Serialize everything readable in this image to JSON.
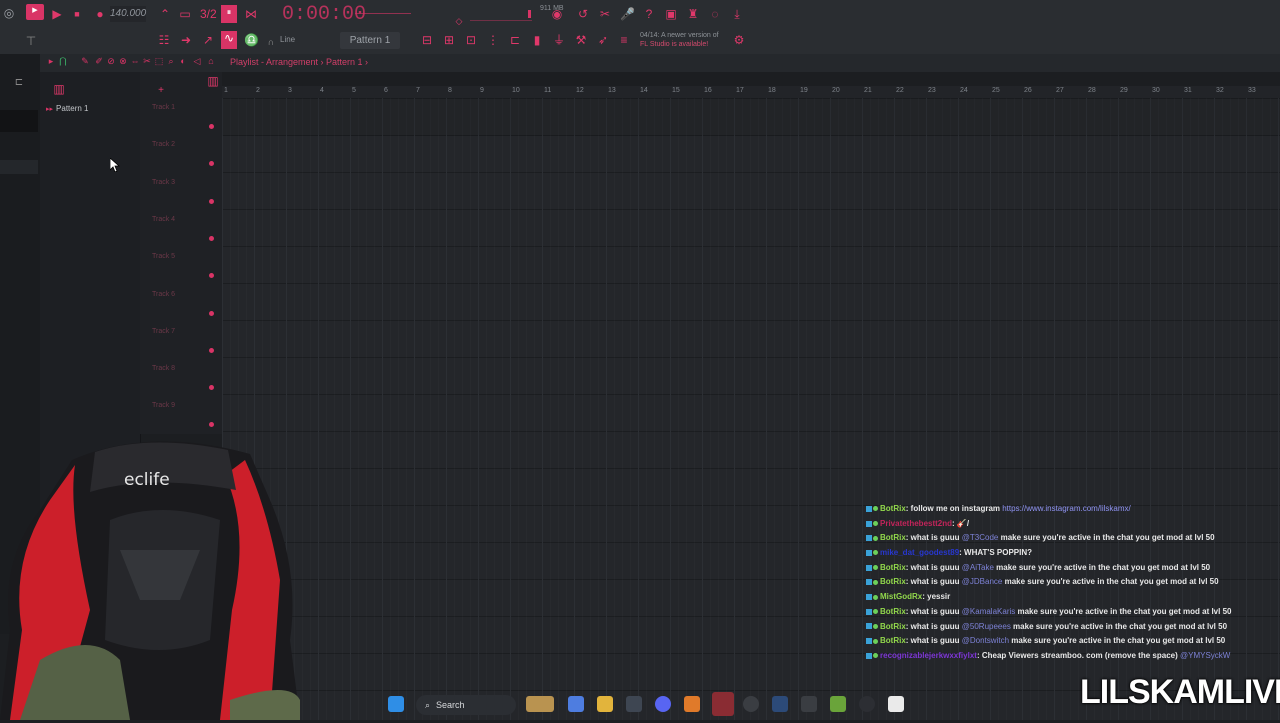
{
  "toolbar": {
    "bpm": "140.000",
    "time": "0:00:00",
    "memory": "911 MB",
    "snap_mode": "Line",
    "pattern": "Pattern 1",
    "news_line1": "04/14: A newer version of",
    "news_line2": "FL Studio is available!"
  },
  "playlist": {
    "breadcrumb": "Playlist - Arrangement › Pattern 1 ›",
    "picker_item": "Pattern 1",
    "tracks": [
      "Track 1",
      "Track 2",
      "Track 3",
      "Track 4",
      "Track 5",
      "Track 6",
      "Track 7",
      "Track 8",
      "Track 9"
    ],
    "ruler": [
      "1",
      "2",
      "3",
      "4",
      "5",
      "6",
      "7",
      "8",
      "9",
      "10",
      "11",
      "12",
      "13",
      "14",
      "15",
      "16",
      "17",
      "18",
      "19",
      "20",
      "21",
      "22",
      "23",
      "24",
      "25",
      "26",
      "27",
      "28",
      "29",
      "30",
      "31",
      "32",
      "33"
    ]
  },
  "chat": {
    "messages": [
      {
        "user": "BotRix",
        "color": "green",
        "pre": ": follow me on instagram ",
        "mention": "",
        "link": "https://www.instagram.com/lilskamx/",
        "post": ""
      },
      {
        "user": "Privatethebestt2nd",
        "color": "red",
        "pre": ": 🎸/",
        "mention": "",
        "link": "",
        "post": ""
      },
      {
        "user": "BotRix",
        "color": "green",
        "pre": ": what is guuu ",
        "mention": "@T3Code",
        "link": "",
        "post": " make sure you're active in the chat you get mod at lvl 50"
      },
      {
        "user": "mike_dat_goodest89",
        "color": "blue",
        "pre": ": WHAT'S POPPIN?",
        "mention": "",
        "link": "",
        "post": ""
      },
      {
        "user": "BotRix",
        "color": "green",
        "pre": ": what is guuu ",
        "mention": "@AiTake",
        "link": "",
        "post": " make sure you're active in the chat you get mod at lvl 50"
      },
      {
        "user": "BotRix",
        "color": "green",
        "pre": ": what is guuu ",
        "mention": "@JDBance",
        "link": "",
        "post": " make sure you're active in the chat you get mod at lvl 50"
      },
      {
        "user": "MistGodRx",
        "color": "green",
        "pre": ": yessir",
        "mention": "",
        "link": "",
        "post": ""
      },
      {
        "user": "BotRix",
        "color": "green",
        "pre": ": what is guuu ",
        "mention": "@KamalaKaris",
        "link": "",
        "post": " make sure you're active in the chat you get mod at lvl 50"
      },
      {
        "user": "BotRix",
        "color": "green",
        "pre": ": what is guuu ",
        "mention": "@50Rupeees",
        "link": "",
        "post": " make sure you're active in the chat you get mod at lvl 50"
      },
      {
        "user": "BotRix",
        "color": "green",
        "pre": ": what is guuu ",
        "mention": "@Dontswitch",
        "link": "",
        "post": " make sure you're active in the chat you get mod at lvl 50"
      },
      {
        "user": "recognizablejerkwxxfiyIxt",
        "color": "purple",
        "pre": ": Cheap Viewers streamboo. com (remove the space) ",
        "mention": "@YMYSyckW",
        "link": "",
        "post": ""
      }
    ]
  },
  "taskbar": {
    "search_label": "Search"
  },
  "overlay": {
    "watermark": "LILSKAMLIVE",
    "chair_brand": "eclife"
  },
  "colors": {
    "accent": "#d93466",
    "background": "#24262a"
  }
}
